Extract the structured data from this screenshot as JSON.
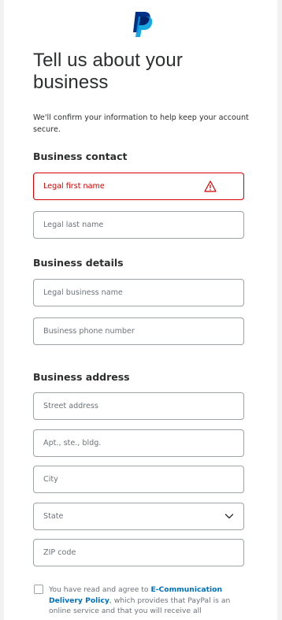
{
  "header": {
    "logo": "paypal-logo",
    "title": "Tell us about your business",
    "subtitle": "We'll confirm your information to help keep your account secure."
  },
  "business_contact": {
    "heading": "Business contact",
    "first_name_placeholder": "Legal first name",
    "first_name_error": true,
    "last_name_placeholder": "Legal last name"
  },
  "business_details": {
    "heading": "Business details",
    "business_name_placeholder": "Legal business name",
    "phone_placeholder": "Business phone number"
  },
  "business_address": {
    "heading": "Business address",
    "street_placeholder": "Street address",
    "apt_placeholder": "Apt., ste., bldg.",
    "city_placeholder": "City",
    "state_placeholder": "State",
    "zip_placeholder": "ZIP code"
  },
  "agreement": {
    "text_before": "You have read and agree to ",
    "link": "E-Communication Delivery Policy",
    "text_after": ", which provides that PayPal is an online service and that you will receive all",
    "checked": false
  },
  "colors": {
    "error": "#d20000",
    "link": "#0070ba",
    "paypal_dark": "#003087",
    "paypal_light": "#009cde"
  },
  "icons": [
    "paypal-logo",
    "warning-icon",
    "chevron-down-icon"
  ]
}
